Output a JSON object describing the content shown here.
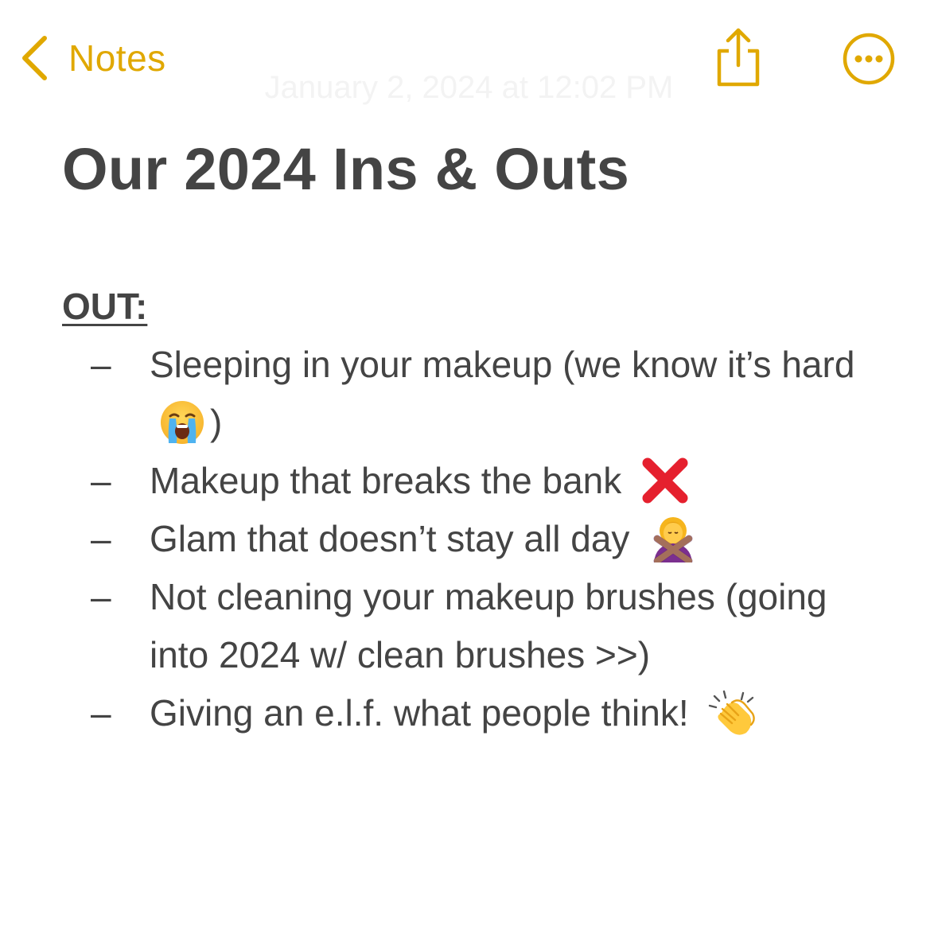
{
  "nav": {
    "back_label": "Notes",
    "accent_color": "#E0A800",
    "share_icon": "share-icon",
    "more_icon": "more-options-icon"
  },
  "note": {
    "date": "January 2, 2024 at 12:02 PM",
    "title": "Our 2024 Ins & Outs",
    "section_heading": "OUT:",
    "dash": "–",
    "items": [
      {
        "text": "Sleeping in your makeup (we know it’s hard",
        "suffix": ")",
        "emoji": "loudly-crying-face-emoji"
      },
      {
        "text": "Makeup that breaks the bank",
        "emoji": "cross-mark-emoji"
      },
      {
        "text": "Glam that doesn’t stay all day",
        "emoji": "person-gesturing-no-emoji"
      },
      {
        "text": "Not cleaning your makeup brushes (going into 2024 w/ clean brushes >>)"
      },
      {
        "text": "Giving an e.l.f. what people think!",
        "emoji": "clapping-hands-emoji"
      }
    ]
  }
}
